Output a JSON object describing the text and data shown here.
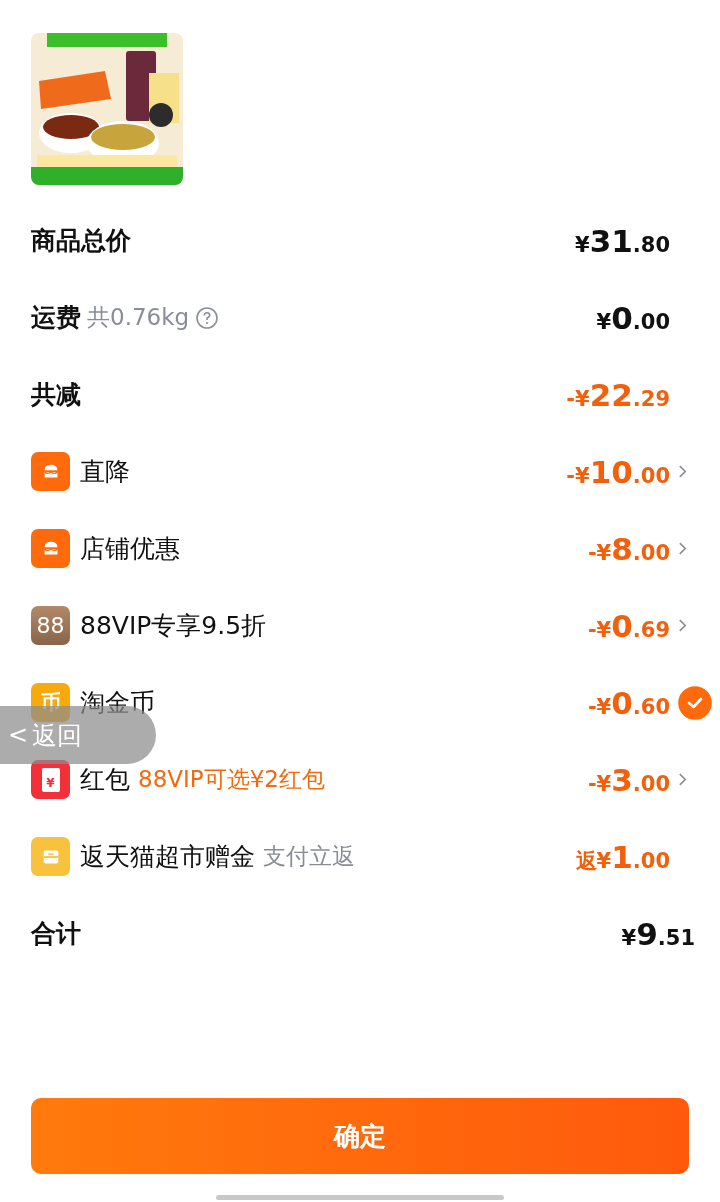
{
  "rows": [
    {
      "kind": "summary",
      "label": "商品总价",
      "amount": {
        "prefix": "¥",
        "integer": "31",
        "decimal": ".80"
      }
    },
    {
      "kind": "summary",
      "label": "运费",
      "note": "共0.76kg",
      "help": true,
      "amount": {
        "prefix": "¥",
        "integer": "0",
        "decimal": ".00"
      }
    },
    {
      "kind": "reduction",
      "label": "共减",
      "amount": {
        "prefix": "-¥",
        "integer": "22",
        "decimal": ".29"
      }
    },
    {
      "kind": "shop",
      "label": "直降",
      "amount": {
        "prefix": "-¥",
        "integer": "10",
        "decimal": ".00"
      }
    },
    {
      "kind": "shop",
      "label": "店铺优惠",
      "amount": {
        "prefix": "-¥",
        "integer": "8",
        "decimal": ".00"
      }
    },
    {
      "kind": "vip",
      "icon_text": "88",
      "label": "88VIP专享9.5折",
      "amount": {
        "prefix": "-¥",
        "integer": "0",
        "decimal": ".69"
      }
    },
    {
      "kind": "coin",
      "icon_text": "币",
      "label": "淘金币",
      "amount": {
        "prefix": "-¥",
        "integer": "0",
        "decimal": ".60"
      },
      "checked": true
    },
    {
      "kind": "redpacket",
      "icon_text": "¥",
      "label": "红包",
      "promo": "88VIP可选¥2红包",
      "amount": {
        "prefix": "-¥",
        "integer": "3",
        "decimal": ".00"
      }
    },
    {
      "kind": "gift",
      "label": "返天猫超市赠金",
      "note": "支付立返",
      "amount": {
        "prefix": "返¥",
        "integer": "1",
        "decimal": ".00"
      }
    },
    {
      "kind": "total",
      "label": "合计",
      "amount": {
        "prefix": "¥",
        "integer": "9",
        "decimal": ".51"
      }
    }
  ],
  "confirm_button": "确定",
  "back_button": {
    "arrow": "<",
    "label": "返回"
  }
}
